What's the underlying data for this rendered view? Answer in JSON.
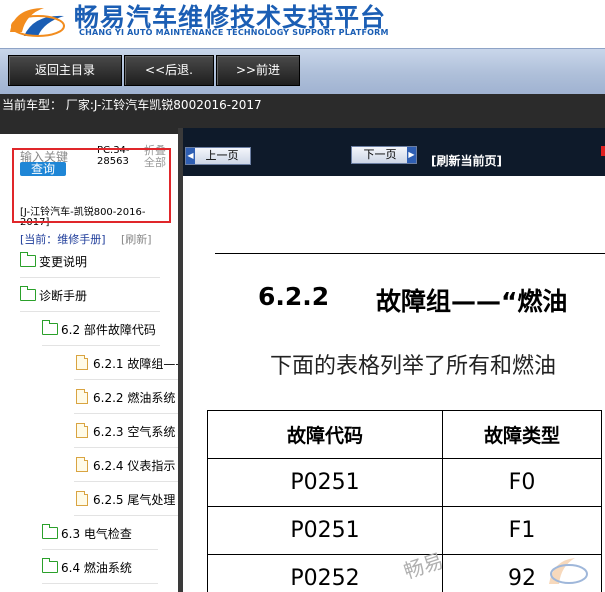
{
  "header": {
    "title_cn": "畅易汽车维修技术支持平台",
    "title_en": "CHANG YI AUTO MAINTENANCE TECHNOLOGY SUPPORT PLATFORM"
  },
  "toolbar": {
    "home_label": "返回主目录",
    "back_label": "<<后退.",
    "forward_label": ">>前进"
  },
  "current_model": "当前车型： 厂家:J-江铃汽车凯锐8002016-2017",
  "sidebar": {
    "search_label": "输入关键",
    "query_label": "查询",
    "pc_code": "PC.34-28563",
    "collapse_label": "折叠全部",
    "vehicle_label": "[J-江铃汽车-凯锐800-2016-2017]",
    "current_label": "[当前：维修手册]",
    "refresh_label": "[刷新]",
    "tree": [
      {
        "label": "变更说明",
        "type": "folder"
      },
      {
        "label": "诊断手册",
        "type": "folder"
      },
      {
        "label": "6.2 部件故障代码",
        "type": "folder"
      },
      {
        "label": "6.2.1 故障组——",
        "type": "page"
      },
      {
        "label": "6.2.2 燃油系统",
        "type": "page"
      },
      {
        "label": "6.2.3 空气系统",
        "type": "page"
      },
      {
        "label": "6.2.4 仪表指示",
        "type": "page"
      },
      {
        "label": "6.2.5 尾气处理",
        "type": "page"
      },
      {
        "label": "6.3 电气检查",
        "type": "folder"
      },
      {
        "label": "6.4 燃油系统",
        "type": "folder"
      }
    ]
  },
  "content_nav": {
    "prev_label": "上一页",
    "next_label": "下一页",
    "refresh_label": "[刷新当前页]"
  },
  "document": {
    "section_number": "6.2.2",
    "section_title": "故障组——“燃油",
    "intro": "下面的表格列举了所有和燃油",
    "table": {
      "headers": [
        "故障代码",
        "故障类型"
      ],
      "rows": [
        [
          "P0251",
          "F0"
        ],
        [
          "P0251",
          "F1"
        ],
        [
          "P0252",
          "92"
        ]
      ]
    },
    "watermark": "畅易"
  },
  "colors": {
    "brand_blue": "#1b5eb4",
    "highlight_red": "#e0262a",
    "query_blue": "#1f86d6"
  }
}
